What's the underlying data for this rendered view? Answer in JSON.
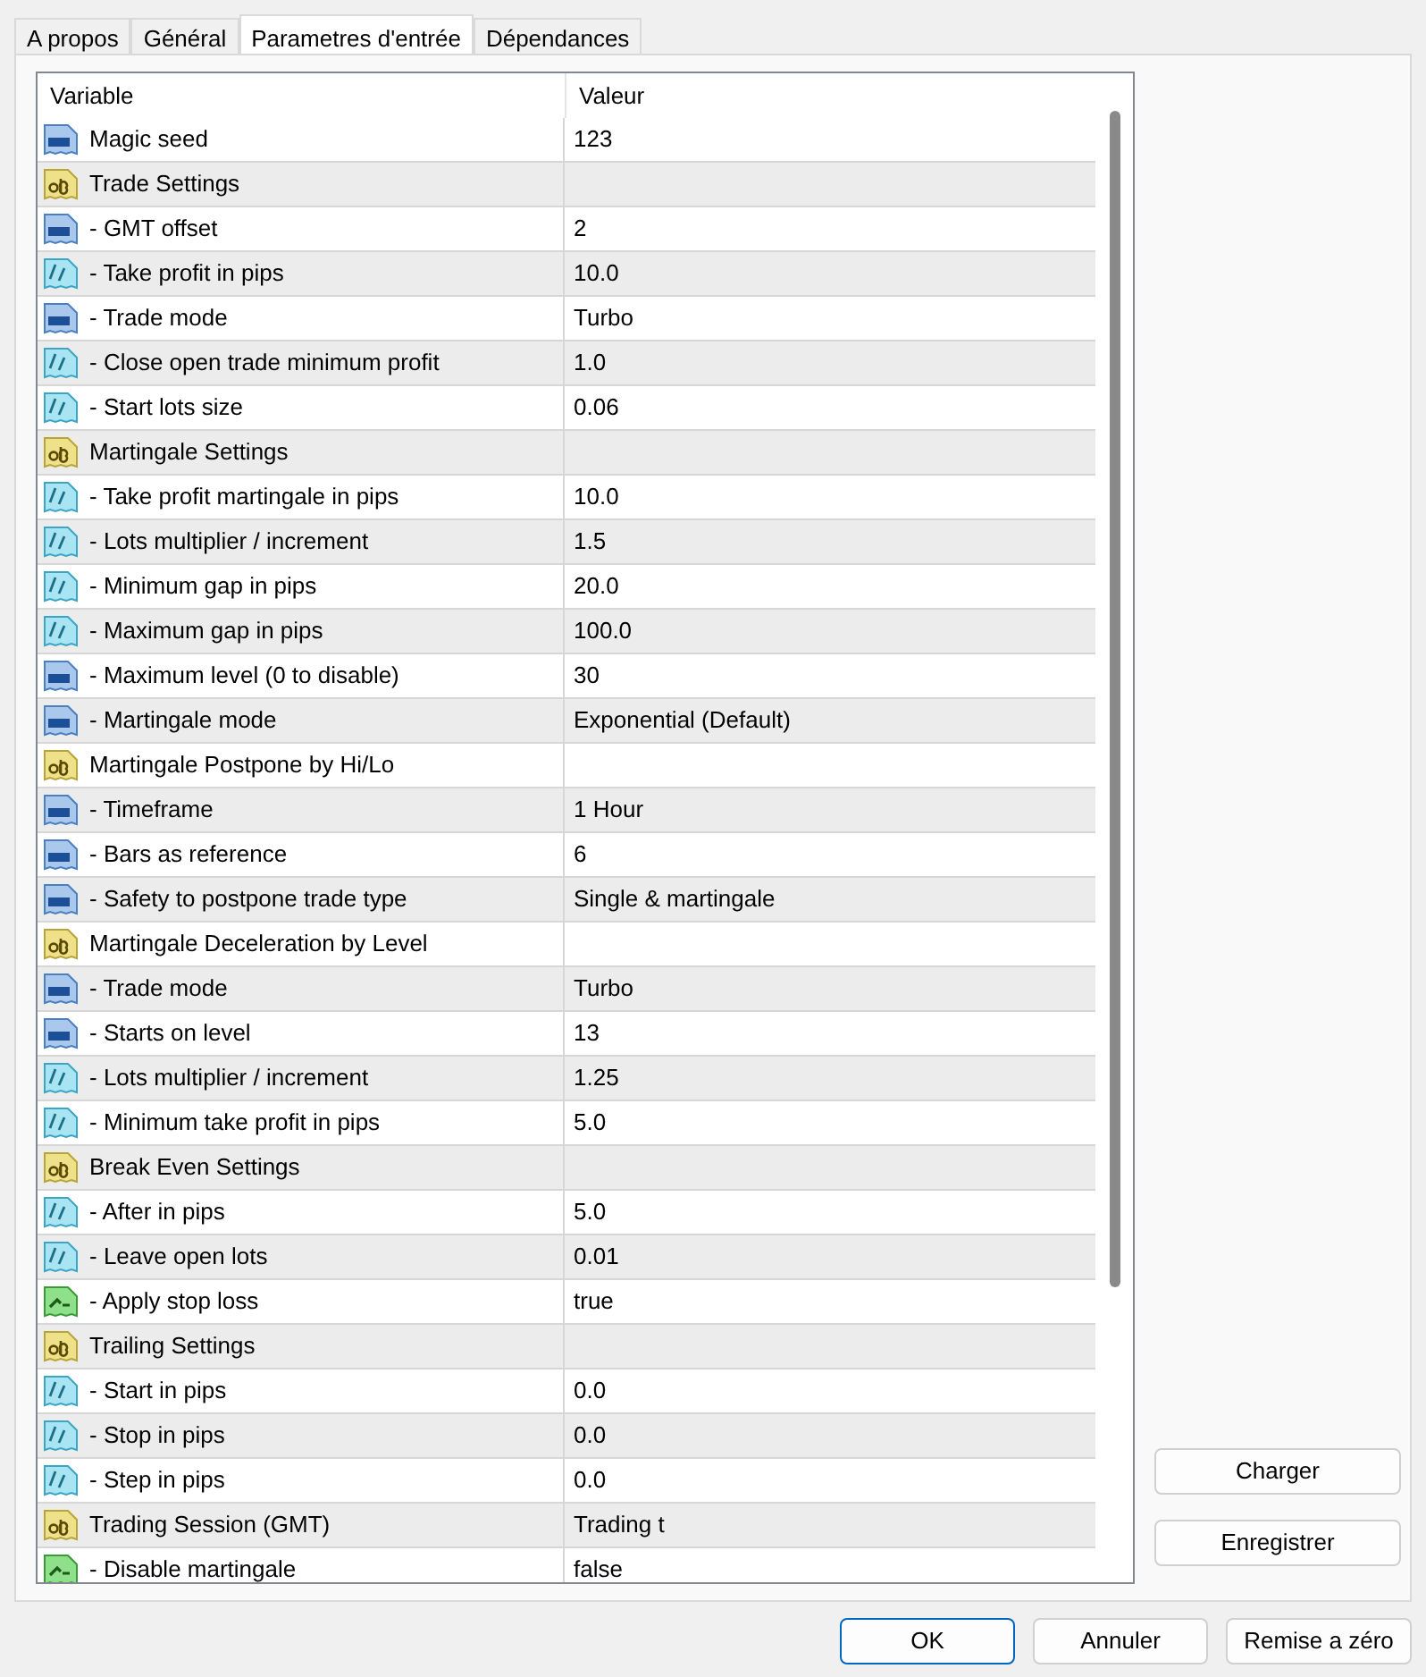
{
  "tabs": [
    {
      "label": "A propos",
      "selected": false
    },
    {
      "label": "Général",
      "selected": false
    },
    {
      "label": "Parametres d'entrée",
      "selected": true
    },
    {
      "label": "Dépendances",
      "selected": false
    }
  ],
  "table": {
    "columns": [
      "Variable",
      "Valeur"
    ],
    "rows": [
      {
        "kind": "int",
        "variable": "Magic seed",
        "value": "123"
      },
      {
        "kind": "string",
        "variable": "Trade Settings",
        "value": ""
      },
      {
        "kind": "int",
        "variable": "- GMT offset",
        "value": "2"
      },
      {
        "kind": "double",
        "variable": "- Take profit in pips",
        "value": "10.0"
      },
      {
        "kind": "int",
        "variable": "- Trade mode",
        "value": "Turbo"
      },
      {
        "kind": "double",
        "variable": "- Close open trade minimum profit",
        "value": "1.0"
      },
      {
        "kind": "double",
        "variable": "- Start lots size",
        "value": "0.06"
      },
      {
        "kind": "string",
        "variable": "Martingale Settings",
        "value": ""
      },
      {
        "kind": "double",
        "variable": "- Take profit martingale in pips",
        "value": "10.0"
      },
      {
        "kind": "double",
        "variable": "- Lots multiplier / increment",
        "value": "1.5"
      },
      {
        "kind": "double",
        "variable": "- Minimum gap in pips",
        "value": "20.0"
      },
      {
        "kind": "double",
        "variable": "- Maximum gap in pips",
        "value": "100.0"
      },
      {
        "kind": "int",
        "variable": "- Maximum level (0 to disable)",
        "value": "30"
      },
      {
        "kind": "int",
        "variable": "- Martingale mode",
        "value": "Exponential (Default)"
      },
      {
        "kind": "string",
        "variable": "Martingale Postpone by Hi/Lo",
        "value": ""
      },
      {
        "kind": "int",
        "variable": "- Timeframe",
        "value": "1 Hour"
      },
      {
        "kind": "int",
        "variable": "- Bars as reference",
        "value": "6"
      },
      {
        "kind": "int",
        "variable": "- Safety to postpone trade type",
        "value": "Single & martingale"
      },
      {
        "kind": "string",
        "variable": "Martingale Deceleration by Level",
        "value": ""
      },
      {
        "kind": "int",
        "variable": "- Trade mode",
        "value": "Turbo"
      },
      {
        "kind": "int",
        "variable": "- Starts on level",
        "value": "13"
      },
      {
        "kind": "double",
        "variable": "- Lots multiplier / increment",
        "value": "1.25"
      },
      {
        "kind": "double",
        "variable": "- Minimum take profit in pips",
        "value": "5.0"
      },
      {
        "kind": "string",
        "variable": "Break Even Settings",
        "value": ""
      },
      {
        "kind": "double",
        "variable": "- After in pips",
        "value": "5.0"
      },
      {
        "kind": "double",
        "variable": "- Leave open lots",
        "value": "0.01"
      },
      {
        "kind": "bool",
        "variable": "- Apply stop loss",
        "value": "true"
      },
      {
        "kind": "string",
        "variable": "Trailing Settings",
        "value": ""
      },
      {
        "kind": "double",
        "variable": "- Start in pips",
        "value": "0.0"
      },
      {
        "kind": "double",
        "variable": "- Stop in pips",
        "value": "0.0"
      },
      {
        "kind": "double",
        "variable": "- Step in pips",
        "value": "0.0"
      },
      {
        "kind": "string",
        "variable": "Trading Session (GMT)",
        "value": "Trading t"
      },
      {
        "kind": "bool",
        "variable": "- Disable martingale",
        "value": "false"
      }
    ]
  },
  "side_buttons": [
    "Charger",
    "Enregistrer"
  ],
  "footer_buttons": [
    {
      "label": "OK",
      "default": true
    },
    {
      "label": "Annuler",
      "default": false
    },
    {
      "label": "Remise a zéro",
      "default": false
    }
  ]
}
